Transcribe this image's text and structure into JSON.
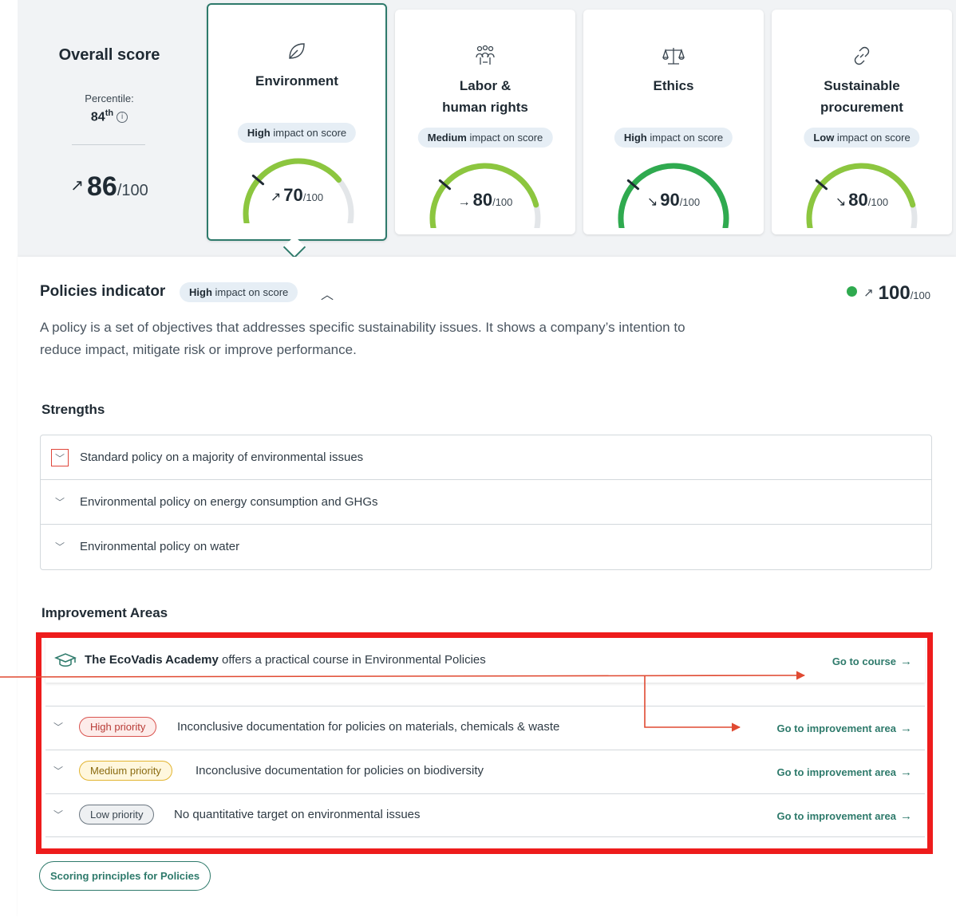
{
  "overall": {
    "title": "Overall score",
    "percentile_label": "Percentile:",
    "percentile_value": "84",
    "percentile_suffix": "th",
    "trend_icon": "arrow-up-right",
    "score": "86",
    "score_of": "/100"
  },
  "themes": [
    {
      "title_line1": "Environment",
      "title_line2": "",
      "icon": "leaf-icon",
      "impact_level": "High",
      "impact_text": " impact on score",
      "trend_arrow": "↗",
      "score": "70",
      "score_of": "/100",
      "gauge_value": 70,
      "gauge_color": "#8cc63f",
      "selected": true
    },
    {
      "title_line1": "Labor &",
      "title_line2": "human rights",
      "icon": "people-icon",
      "impact_level": "Medium",
      "impact_text": " impact on score",
      "trend_arrow": "→",
      "score": "80",
      "score_of": "/100",
      "gauge_value": 80,
      "gauge_color": "#8cc63f",
      "selected": false
    },
    {
      "title_line1": "Ethics",
      "title_line2": "",
      "icon": "scales-icon",
      "impact_level": "High",
      "impact_text": " impact on score",
      "trend_arrow": "↘",
      "score": "90",
      "score_of": "/100",
      "gauge_value": 90,
      "gauge_color": "#2faa4f",
      "selected": false
    },
    {
      "title_line1": "Sustainable",
      "title_line2": "procurement",
      "icon": "link-icon",
      "impact_level": "Low",
      "impact_text": " impact on score",
      "trend_arrow": "↘",
      "score": "80",
      "score_of": "/100",
      "gauge_value": 80,
      "gauge_color": "#8cc63f",
      "selected": false
    }
  ],
  "indicator": {
    "title": "Policies indicator",
    "impact_level": "High",
    "impact_text": " impact on score",
    "status_color": "#2faa4f",
    "trend_arrow": "↗",
    "score": "100",
    "score_of": "/100",
    "description": "A policy is a set of objectives that addresses specific sustainability issues. It shows a company’s intention to reduce impact, mitigate risk or improve performance."
  },
  "strengths": {
    "title": "Strengths",
    "items": [
      "Standard policy on a majority of environmental issues",
      "Environmental policy on energy consumption and GHGs",
      "Environmental policy on water"
    ]
  },
  "improvement": {
    "title": "Improvement Areas",
    "academy_name": "The EcoVadis Academy",
    "academy_text": " offers a practical course in Environmental Policies",
    "course_link": "Go to course",
    "link_label": "Go to improvement area",
    "items": [
      {
        "priority": "High priority",
        "text": "Inconclusive documentation for policies on materials, chemicals & waste"
      },
      {
        "priority": "Medium priority",
        "text": "Inconclusive documentation for policies on biodiversity"
      },
      {
        "priority": "Low priority",
        "text": "No quantitative target on environmental issues"
      }
    ]
  },
  "principles_button": "Scoring principles for Policies",
  "colors": {
    "accent": "#2e7a6b",
    "gauge_track": "#e3e6e9",
    "highlight_box": "#ee1c1c",
    "annotation_arrow": "#e04a32"
  }
}
